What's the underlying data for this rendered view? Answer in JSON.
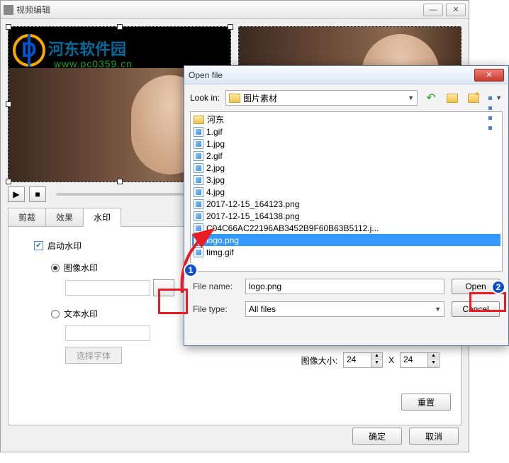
{
  "window": {
    "title": "视频编辑",
    "minimize": "—",
    "close": "✕"
  },
  "watermark": {
    "brand": "河东软件园",
    "url": "www.pc0359.cn"
  },
  "controls": {
    "play": "▶",
    "stop": "■"
  },
  "tabs": {
    "crop": "剪裁",
    "effect": "效果",
    "watermark": "水印"
  },
  "panel": {
    "enable": "启动水印",
    "image_radio": "图像水印",
    "text_radio": "文本水印",
    "browse_icon": "...",
    "font_button": "选择字体",
    "size_label": "图像大小:",
    "size_w": "24",
    "size_x": "X",
    "size_h": "24",
    "reset": "重置"
  },
  "buttons": {
    "ok": "确定",
    "cancel": "取消"
  },
  "dialog": {
    "title": "Open file",
    "close": "✕",
    "lookin_label": "Look in:",
    "lookin_value": "图片素材",
    "files": [
      {
        "name": "河东",
        "type": "folder"
      },
      {
        "name": "1.gif",
        "type": "img"
      },
      {
        "name": "1.jpg",
        "type": "img"
      },
      {
        "name": "2.gif",
        "type": "img"
      },
      {
        "name": "2.jpg",
        "type": "img"
      },
      {
        "name": "3.jpg",
        "type": "img"
      },
      {
        "name": "4.jpg",
        "type": "img"
      },
      {
        "name": "2017-12-15_164123.png",
        "type": "img"
      },
      {
        "name": "2017-12-15_164138.png",
        "type": "img"
      },
      {
        "name": "C04C66AC22196AB3452B9F60B63B5112.j...",
        "type": "img"
      },
      {
        "name": "logo.png",
        "type": "img",
        "selected": true
      },
      {
        "name": "timg.gif",
        "type": "img"
      }
    ],
    "filename_label": "File name:",
    "filename_value": "logo.png",
    "filetype_label": "File type:",
    "filetype_value": "All files",
    "open": "Open",
    "cancel": "Cancel"
  },
  "annotations": {
    "n1": "1",
    "n2": "2"
  }
}
